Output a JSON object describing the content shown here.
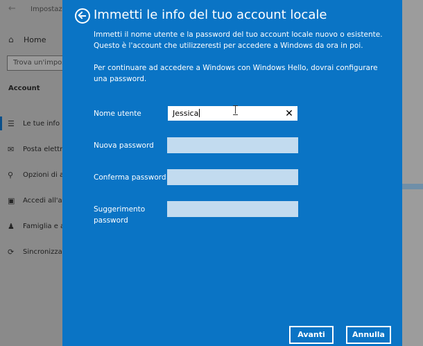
{
  "background": {
    "window_title": "Impostazioni",
    "back_icon": "arrow-left-icon",
    "home_label": "Home",
    "search_placeholder": "Trova un'impost",
    "section_title": "Account",
    "nav": [
      {
        "label": "Le tue info",
        "icon": "person-card-icon",
        "active": true
      },
      {
        "label": "Posta elettro",
        "icon": "mail-icon",
        "active": false
      },
      {
        "label": "Opzioni di ac",
        "icon": "key-icon",
        "active": false
      },
      {
        "label": "Accedi all'az",
        "icon": "briefcase-icon",
        "active": false
      },
      {
        "label": "Famiglia e al",
        "icon": "person-add-icon",
        "active": false
      },
      {
        "label": "Sincronizza l",
        "icon": "sync-icon",
        "active": false
      }
    ]
  },
  "dialog": {
    "title": "Immetti le info del tuo account locale",
    "paragraph1": "Immetti il nome utente e la password del tuo account locale nuovo o esistente. Questo è l'account che utilizzeresti per accedere a Windows da ora in poi.",
    "paragraph2": "Per continuare ad accedere a Windows con Windows Hello, dovrai configurare una password.",
    "fields": {
      "username_label": "Nome utente",
      "username_value": "Jessica",
      "new_password_label": "Nuova password",
      "confirm_password_label": "Conferma password",
      "hint_label": "Suggerimento password"
    },
    "buttons": {
      "next": "Avanti",
      "cancel": "Annulla"
    },
    "colors": {
      "background": "#0a74c5",
      "input": "#c2dbef"
    }
  }
}
